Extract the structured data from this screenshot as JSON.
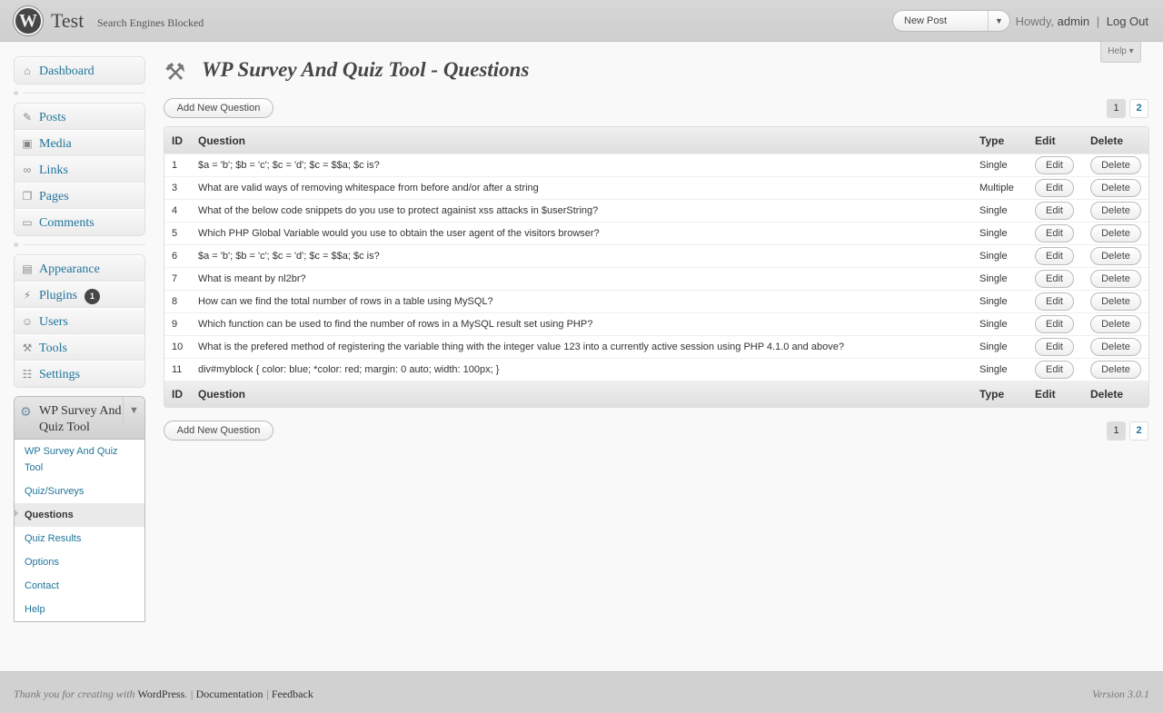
{
  "header": {
    "site_title": "Test",
    "site_status": "Search Engines Blocked",
    "favorite_action": "New Post",
    "howdy": "Howdy,",
    "username": "admin",
    "separator": "|",
    "logout": "Log Out"
  },
  "help_tab": "Help",
  "menu": {
    "dashboard": "Dashboard",
    "posts": "Posts",
    "media": "Media",
    "links": "Links",
    "pages": "Pages",
    "comments": "Comments",
    "appearance": "Appearance",
    "plugins": "Plugins",
    "plugins_badge": "1",
    "users": "Users",
    "tools": "Tools",
    "settings": "Settings",
    "wpsqt": "WP Survey And Quiz Tool",
    "submenu": [
      "WP Survey And Quiz Tool",
      "Quiz/Surveys",
      "Questions",
      "Quiz Results",
      "Options",
      "Contact",
      "Help"
    ]
  },
  "page": {
    "title": "WP Survey And Quiz Tool - Questions",
    "add_button": "Add New Question",
    "pages": [
      "1",
      "2"
    ]
  },
  "table": {
    "columns": [
      "ID",
      "Question",
      "Type",
      "Edit",
      "Delete"
    ],
    "rows": [
      {
        "id": "1",
        "question": "$a = 'b'; $b = 'c'; $c = 'd'; $c = $$a; $c is?",
        "type": "Single"
      },
      {
        "id": "3",
        "question": "What are valid ways of removing whitespace from before and/or after a string",
        "type": "Multiple"
      },
      {
        "id": "4",
        "question": "What of the below code snippets do you use to protect againist xss attacks in $userString?",
        "type": "Single"
      },
      {
        "id": "5",
        "question": "Which PHP Global Variable would you use to obtain the user agent of the visitors browser?",
        "type": "Single"
      },
      {
        "id": "6",
        "question": "$a = 'b'; $b = 'c'; $c = 'd'; $c = $$a; $c is?",
        "type": "Single"
      },
      {
        "id": "7",
        "question": "What is meant by nl2br?",
        "type": "Single"
      },
      {
        "id": "8",
        "question": "How can we find the total number of rows in a table using MySQL?",
        "type": "Single"
      },
      {
        "id": "9",
        "question": "Which function can be used to find the number of rows in a MySQL result set using PHP?",
        "type": "Single"
      },
      {
        "id": "10",
        "question": "What is the prefered method of registering the variable thing with the integer value 123 into a currently active session using PHP 4.1.0 and above?",
        "type": "Single"
      },
      {
        "id": "11",
        "question": "div#myblock { color: blue; *color: red; margin: 0 auto; width: 100px; }",
        "type": "Single"
      }
    ],
    "edit_label": "Edit",
    "delete_label": "Delete"
  },
  "footer": {
    "thanks": "Thank you for creating with",
    "wordpress": "WordPress",
    "documentation": "Documentation",
    "feedback": "Feedback",
    "version": "Version 3.0.1"
  }
}
